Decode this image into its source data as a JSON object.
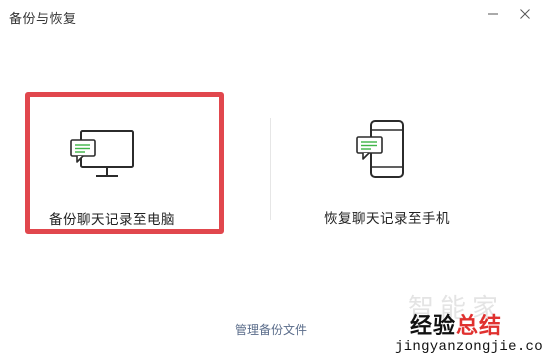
{
  "window": {
    "title": "备份与恢复"
  },
  "options": {
    "backup_to_pc": {
      "label": "备份聊天记录至电脑"
    },
    "restore_to_phone": {
      "label": "恢复聊天记录至手机"
    }
  },
  "footer": {
    "manage_label": "管理备份文件"
  },
  "watermark": {
    "top_text": "智能家",
    "logo_part1": "经验",
    "logo_part2": "总结",
    "url": "jingyanzongjie.com"
  },
  "colors": {
    "highlight_border": "#e1474d",
    "bubble_green": "#3fb548",
    "link": "#5a6c8a"
  }
}
